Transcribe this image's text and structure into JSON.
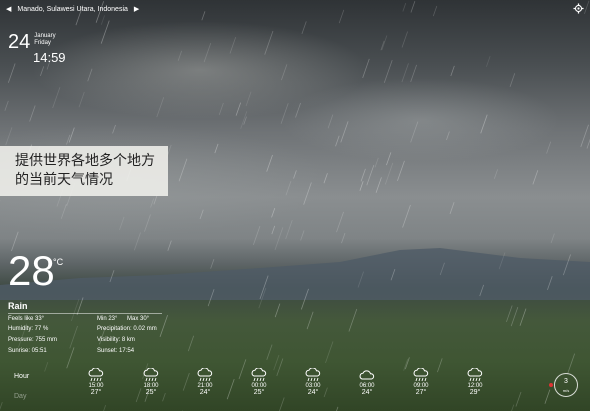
{
  "header": {
    "location": "Manado, Sulawesi Utara, Indonesia",
    "prev_arrow": "◀",
    "next_arrow": "▶"
  },
  "date": {
    "day": "24",
    "month": "January",
    "weekday": "Friday",
    "time": "14:59"
  },
  "banner": {
    "line1": "提供世界各地多个地方",
    "line2": "的当前天气情况"
  },
  "current": {
    "temperature": "28",
    "unit": "°C",
    "condition": "Rain",
    "feels_like": "Feels like 33°",
    "min": "Min 23°",
    "max": "Max 30°",
    "humidity": "Humidity: 77 %",
    "precipitation": "Precipitation: 0.02 mm",
    "pressure": "Pressure: 755 mm",
    "visibility": "Visibility: 8 km",
    "sunrise": "Sunrise: 05:51",
    "sunset": "Sunset: 17:54"
  },
  "tabs": {
    "hour": "Hour",
    "day": "Day"
  },
  "hourly": [
    {
      "time": "15:00",
      "temp": "27°",
      "icon": "rain-cloud-icon"
    },
    {
      "time": "18:00",
      "temp": "25°",
      "icon": "rain-cloud-icon"
    },
    {
      "time": "21:00",
      "temp": "24°",
      "icon": "rain-cloud-icon"
    },
    {
      "time": "00:00",
      "temp": "25°",
      "icon": "rain-cloud-icon"
    },
    {
      "time": "03:00",
      "temp": "24°",
      "icon": "rain-cloud-icon"
    },
    {
      "time": "06:00",
      "temp": "24°",
      "icon": "cloud-icon"
    },
    {
      "time": "09:00",
      "temp": "27°",
      "icon": "rain-cloud-icon"
    },
    {
      "time": "12:00",
      "temp": "29°",
      "icon": "rain-cloud-icon"
    }
  ],
  "wind": {
    "speed": "3",
    "unit": "m/s"
  }
}
